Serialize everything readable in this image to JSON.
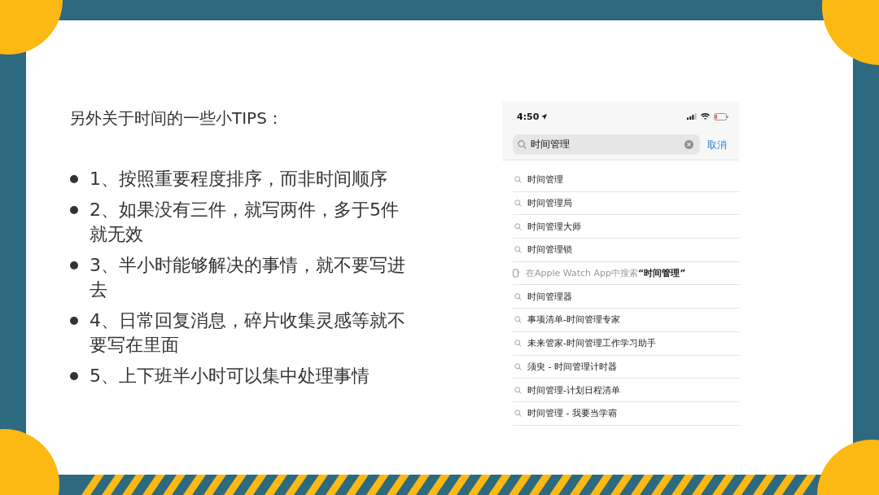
{
  "slide": {
    "title": "另外关于时间的一些小TIPS：",
    "tips": [
      "1、按照重要程度排序，而非时间顺序",
      "2、如果没有三件，就写两件，多于5件就无效",
      "3、半小时能够解决的事情，就不要写进去",
      "4、日常回复消息，碎片收集灵感等就不要写在里面",
      "5、上下班半小时可以集中处理事情"
    ]
  },
  "phone_screenshot": {
    "status_bar": {
      "time": "4:50"
    },
    "search": {
      "value": "时间管理",
      "cancel": "取消"
    },
    "suggestions": [
      {
        "kind": "search",
        "text": "时间管理"
      },
      {
        "kind": "search",
        "text": "时间管理局"
      },
      {
        "kind": "search",
        "text": "时间管理大师"
      },
      {
        "kind": "search",
        "text": "时间管理锁"
      },
      {
        "kind": "watch",
        "text": "在Apple Watch App中搜索**“时间管理”**"
      },
      {
        "kind": "search",
        "text": "时间管理器"
      },
      {
        "kind": "search",
        "text": "事项清单-时间管理专家"
      },
      {
        "kind": "search",
        "text": "未来管家-时间管理工作学习助手"
      },
      {
        "kind": "search",
        "text": "须臾 - 时间管理计时器"
      },
      {
        "kind": "search",
        "text": "时间管理-计划日程清单"
      },
      {
        "kind": "search",
        "text": "时间管理 - 我要当学霸"
      }
    ]
  }
}
